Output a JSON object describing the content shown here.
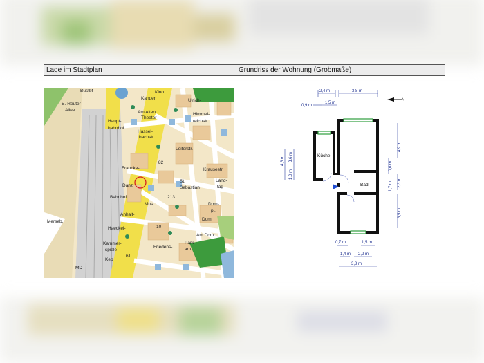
{
  "header": {
    "left_label": "Lage im Stadtplan",
    "right_label": "Grundriss der Wohnung (Grobmaße)"
  },
  "map": {
    "labels": [
      {
        "id": "kino",
        "text": "Kino"
      },
      {
        "id": "bustbf",
        "text": "Bustbf"
      },
      {
        "id": "kander",
        "text": "Kander"
      },
      {
        "id": "ulrich",
        "text": "Ulrich-"
      },
      {
        "id": "reuter",
        "text": "E.-Reuter-"
      },
      {
        "id": "allee",
        "text": "Allee"
      },
      {
        "id": "amalten",
        "text": "Am Alten"
      },
      {
        "id": "theater",
        "text": "Theater"
      },
      {
        "id": "haupt",
        "text": "Haupt-"
      },
      {
        "id": "bahnhof",
        "text": "bahnhof"
      },
      {
        "id": "hassel",
        "text": "Hassel-"
      },
      {
        "id": "bachstr",
        "text": "bachstr."
      },
      {
        "id": "himmel",
        "text": "Himmel-"
      },
      {
        "id": "reichstr",
        "text": "reichstr."
      },
      {
        "id": "leiterstr",
        "text": "Leiterstr."
      },
      {
        "id": "krausestr",
        "text": "Krausestr."
      },
      {
        "id": "francke",
        "text": "Francke-"
      },
      {
        "id": "danz",
        "text": "Danz"
      },
      {
        "id": "st",
        "text": "St."
      },
      {
        "id": "sebastian",
        "text": "Sebastian"
      },
      {
        "id": "landtag",
        "text": "Land-"
      },
      {
        "id": "tag",
        "text": "tag"
      },
      {
        "id": "domplatz",
        "text": "Dom-"
      },
      {
        "id": "pl",
        "text": "pl."
      },
      {
        "id": "dom",
        "text": "Dom"
      },
      {
        "id": "anhalt",
        "text": "Anhalt-"
      },
      {
        "id": "haeckel",
        "text": "Haeckel-"
      },
      {
        "id": "kammer",
        "text": "Kammer-"
      },
      {
        "id": "spiele",
        "text": "spiele"
      },
      {
        "id": "friedens",
        "text": "Friedens-"
      },
      {
        "id": "park",
        "text": "Park"
      },
      {
        "id": "am",
        "text": "am"
      },
      {
        "id": "amdom",
        "text": "Am Dom"
      },
      {
        "id": "md",
        "text": "MD-"
      },
      {
        "id": "merseb",
        "text": "Merseb."
      },
      {
        "id": "kep",
        "text": "Kep"
      },
      {
        "id": "bahnhstr",
        "text": "Bahnhof"
      },
      {
        "id": "mus",
        "text": "Mus"
      },
      {
        "id": "n213",
        "text": "213"
      },
      {
        "id": "n10",
        "text": "10"
      },
      {
        "id": "n82",
        "text": "82"
      },
      {
        "id": "n61",
        "text": "61"
      }
    ]
  },
  "plan": {
    "north": "N",
    "dims": {
      "top1": "2,4 m",
      "top2": "3,8 m",
      "top3": "0,9 m",
      "top4": "1,5 m",
      "left1": "4,6 m",
      "left2": "3,6 m",
      "left3": "1,0 m",
      "right1": "4,9 m",
      "right2": "0,6 m",
      "right3": "1,7 m",
      "right4": "2,3 m",
      "right5": "3,5 m",
      "bot1": "0,7 m",
      "bot2": "1,5 m",
      "bot3": "1,4 m",
      "bot4": "2,2 m",
      "bot5": "3,8 m"
    },
    "rooms": {
      "kitchen": "Küche",
      "bath": "Bad"
    }
  }
}
